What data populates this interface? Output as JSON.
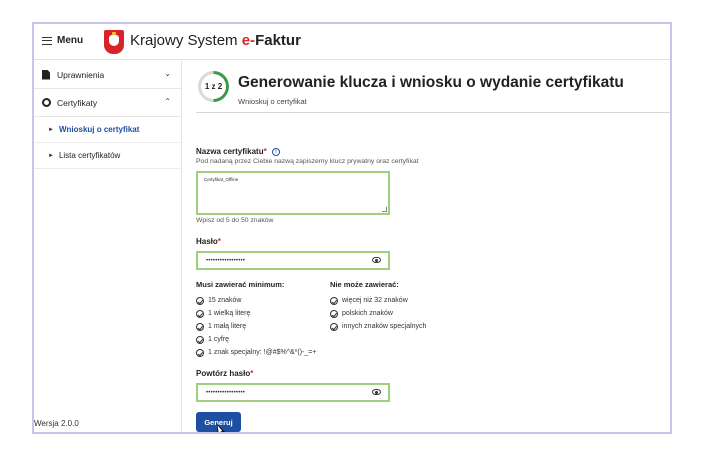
{
  "topbar": {
    "menu_label": "Menu",
    "brand_part1": "Krajowy Syst",
    "brand_part2": "em ",
    "brand_accent": "e-",
    "brand_bold": "Faktur"
  },
  "sidebar": {
    "items": [
      {
        "label": "Uprawnienia",
        "icon": "document-icon",
        "chevron": "⌄"
      },
      {
        "label": "Certyfikaty",
        "icon": "certificate-icon",
        "chevron": "⌃"
      }
    ],
    "subitems": [
      {
        "label": "Wnioskuj o certyfikat",
        "active": true
      },
      {
        "label": "Lista certyfikatów",
        "active": false
      }
    ],
    "version": "Wersja 2.0.0"
  },
  "main": {
    "step": "1 z 2",
    "title": "Generowanie klucza i wniosku o wydanie certyfikatu",
    "subtitle": "Wnioskuj o certyfikat",
    "cert_name": {
      "label": "Nazwa certyfikatu",
      "required_mark": "*",
      "description": "Pod nadaną przez Ciebie nazwą zapiszemy klucz prywatny oraz certyfikat",
      "value": "Certyfikat_Offline",
      "hint": "Wpisz od 5 do 50 znaków"
    },
    "password": {
      "label": "Hasło",
      "required_mark": "*",
      "value": "•••••••••••••••••"
    },
    "must_contain": {
      "heading": "Musi zawierać minimum:",
      "items": [
        "15 znaków",
        "1 wielką literę",
        "1 małą literę",
        "1 cyfrę",
        "1 znak specjalny: !@#$%^&*()-_=+"
      ]
    },
    "must_not_contain": {
      "heading": "Nie może zawierać:",
      "items": [
        "więcej niż 32 znaków",
        "polskich znaków",
        "innych znaków specjalnych"
      ]
    },
    "repeat_password": {
      "label": "Powtórz hasło",
      "required_mark": "*",
      "value": "•••••••••••••••••"
    },
    "submit_label": "Generuj"
  },
  "colors": {
    "accent_blue": "#1f4fa3",
    "valid_green": "#9fcf7c",
    "progress_green": "#3a9a4a",
    "required_red": "#d8232a"
  },
  "step_progress_fraction": 0.5
}
